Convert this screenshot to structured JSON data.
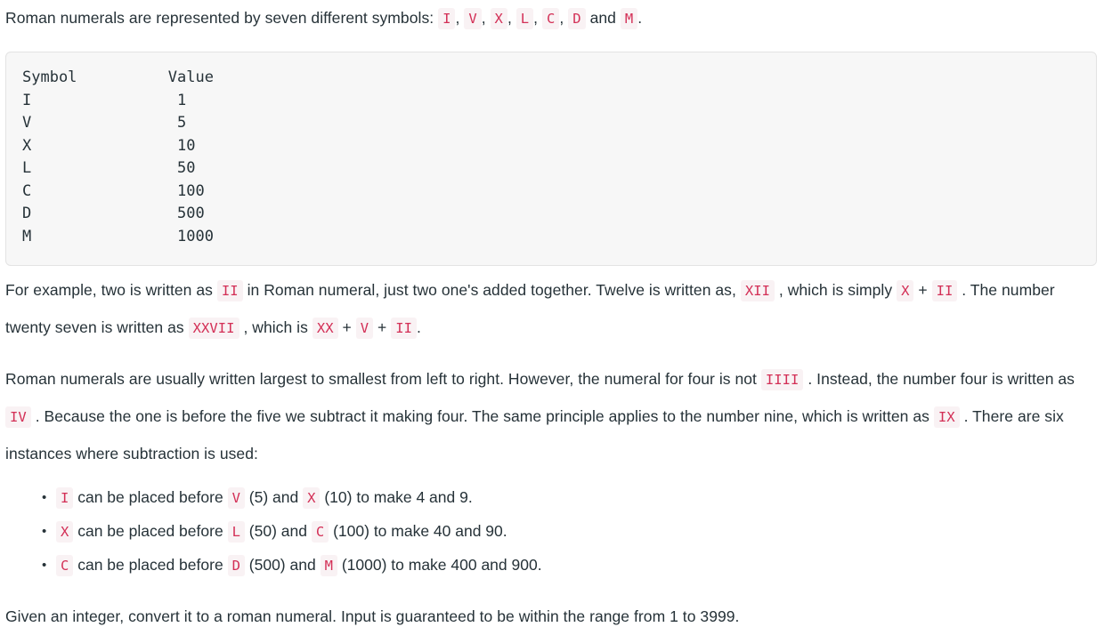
{
  "theme": {
    "page_background": "#ffffff",
    "text_color": "#263238",
    "code_text_color": "#d32f56",
    "code_background": "#f9f2f4",
    "pre_background": "#f7f7f7",
    "pre_border": "#e3e3e3"
  },
  "intro": {
    "lead": "Roman numerals are represented by seven different symbols:",
    "symbols": [
      "I",
      "V",
      "X",
      "L",
      "C",
      "D",
      "M"
    ],
    "separator": ",",
    "conjunction": "and",
    "terminator": "."
  },
  "symbol_table": {
    "headers": [
      "Symbol",
      "Value"
    ],
    "rows": [
      {
        "symbol": "I",
        "value": "1"
      },
      {
        "symbol": "V",
        "value": "5"
      },
      {
        "symbol": "X",
        "value": "10"
      },
      {
        "symbol": "L",
        "value": "50"
      },
      {
        "symbol": "C",
        "value": "100"
      },
      {
        "symbol": "D",
        "value": "500"
      },
      {
        "symbol": "M",
        "value": "1000"
      }
    ],
    "rendered_text": "Symbol          Value\nI                1\nV                5\nX                10\nL                50\nC                100\nD                500\nM                1000"
  },
  "example_paragraph": {
    "t1": "For example, two is written as",
    "c1": "II",
    "t2": "in Roman numeral, just two one's added together. Twelve is written as,",
    "c2": "XII",
    "t3": ", which is simply",
    "c3": "X",
    "t4": "+",
    "c4": "II",
    "t5": ". The number twenty seven is written as",
    "c5": "XXVII",
    "t6": ", which is",
    "c6": "XX",
    "t7": "+",
    "c7": "V",
    "t8": "+",
    "c8": "II",
    "t9": "."
  },
  "subtraction_paragraph": {
    "t1": "Roman numerals are usually written largest to smallest from left to right. However, the numeral for four is not",
    "c1": "IIII",
    "t2": ". Instead, the number four is written as",
    "c2": "IV",
    "t3": ". Because the one is before the five we subtract it making four. The same principle applies to the number nine, which is written as",
    "c3": "IX",
    "t4": ". There are six instances where subtraction is used:"
  },
  "subtraction_rules": [
    {
      "subject": "I",
      "mid1": "can be placed before",
      "first": "V",
      "first_value": "(5)",
      "mid2": "and",
      "second": "X",
      "second_value": "(10)",
      "tail": "to make 4 and 9."
    },
    {
      "subject": "X",
      "mid1": "can be placed before",
      "first": "L",
      "first_value": "(50)",
      "mid2": "and",
      "second": "C",
      "second_value": "(100)",
      "tail": "to make 40 and 90."
    },
    {
      "subject": "C",
      "mid1": "can be placed before",
      "first": "D",
      "first_value": "(500)",
      "mid2": "and",
      "second": "M",
      "second_value": "(1000)",
      "tail": "to make 400 and 900."
    }
  ],
  "closing_paragraph": {
    "text": "Given an integer, convert it to a roman numeral. Input is guaranteed to be within the range from 1 to 3999."
  }
}
